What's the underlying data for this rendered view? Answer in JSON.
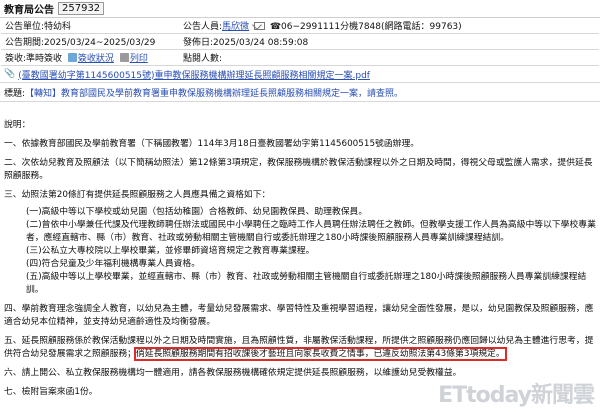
{
  "header": {
    "title": "教育局公告",
    "number": "257932"
  },
  "meta": {
    "unit_label": "公告單位:特幼科",
    "contact_label": "公告人員:",
    "contact_name": "馬欣微",
    "phone": "06−2991111分機7848(網路電話：99763)",
    "period_label": "公告期間:2025/03/24~2025/03/29",
    "publish_label": "發佈日:2025/03/24 08:59:08",
    "sign_label": "簽收:準時簽收",
    "sign_link": "簽收狀況",
    "print_link": "列印",
    "hits_label": "點閱人數:"
  },
  "attachment": {
    "text": "(臺教國署幼字第1145600515號)重申教保服務機構辦理延長照顧服務相關規定一案.pdf"
  },
  "subject": {
    "label": "標題:",
    "value": "【轉知】教育部國民及學前教育署重申教保服務機構辦理延長照顧服務相關規定一案，請查照。"
  },
  "body": {
    "heading": "說明：",
    "p1": "一、依據教育部國民及學前教育署（下稱國教署）114年3月18日臺教國署幼字第1145600515號函辦理。",
    "p2": "二、次依幼兒教育及照顧法（以下簡稱幼照法）第12條第3項規定，教保服務機構於教保活動課程以外之日期及時間，得視父母或監護人需求，提供延長照顧服務。",
    "p3": "三、幼照法第20條訂有提供延長照顧服務之人員應具備之資格如下：",
    "p3_1": "(一)高級中等以下學校或幼兒園（包括幼稚園）合格教師、幼兒園教保員、助理教保員。",
    "p3_2": "(二)曾依中小學兼任代課及代理教師聘任辦法或國民中小學聘任之臨時工作人員聘任辦法聘任之教師。但教學支援工作人員為高級中等以下學校專業者，應經直轄市、縣（市）教育、社政或勞動相關主管機關自行或委託辦理之180小時課後照顧服務人員專業訓練課程結訓。",
    "p3_3": "(三)公私立大專校院以上學校畢業，並修畢師資培育規定之教育專業課程。",
    "p3_4": "(四)符合兒童及少年福利機構專業人員資格。",
    "p3_5": "(五)高級中等以上學校畢業，並經直轄市、縣（市）教育、社政或勞動相關主管機關自行或委託辦理之180小時課後照顧服務人員專業訓練課程結訓。",
    "p4": "四、學前教育理念強調全人教育，以幼兒為主體，考量幼兒發展需求、學習特性及重視學習過程，讓幼兒全面性發展，是以，幼兒園教保及照顧服務，應適合幼兒本位精神，並支持幼兒適齡適性及均衡發展。",
    "p5a": "五、延長照顧服務係於教保活動課程以外之日期及時間實施，且為照顧性質，非屬教保活動課程，所提供之照顧服務仍應回歸以幼兒為主體進行思考，提供符合幼兒發展需求之照顧服務；",
    "p5b": "倘延長照顧服務期間有招收課後才藝班且向家長收費之情事，已違反幼照法第43條第3項規定。",
    "p6": "六、請上開公、私立教保服務機構均一體適用，請各教保服務機構確依規定提供延長照顧服務，以維護幼兒受教權益。",
    "p7": "七、檢附旨案來函1份。"
  },
  "watermark": {
    "text": "ETtoday新聞雲"
  }
}
